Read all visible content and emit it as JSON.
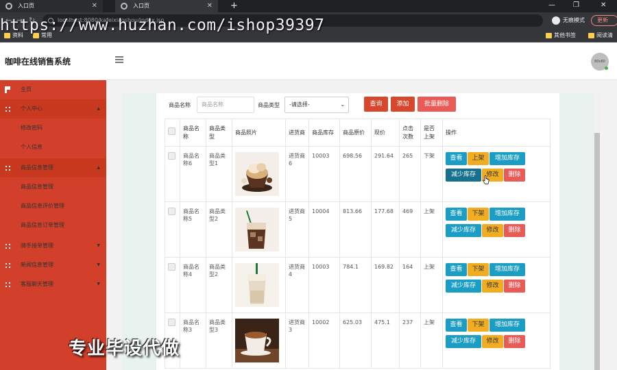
{
  "browser": {
    "tabs": [
      {
        "label": "入口页",
        "active": false
      },
      {
        "label": "入口页",
        "active": true
      }
    ],
    "new_tab": "+",
    "window_controls": {
      "minimize": "—",
      "maximize": "❐",
      "close": "✕"
    },
    "nav": {
      "back": "←",
      "forward": "→",
      "reload": "↻"
    },
    "url": "localhost:8080/kafeixiaoshou/index.jsp",
    "profile_label": "无痕模式",
    "update_label": "更新",
    "bookmarks": [
      {
        "label": "资料"
      },
      {
        "label": "常用"
      },
      {
        "label": "其他书签"
      },
      {
        "label": "阅读清单"
      }
    ],
    "watermark": "https://www.huzhan.com/ishop39397"
  },
  "app": {
    "title": "咖啡在线销售系统",
    "user_avatar_text": "80x80"
  },
  "sidebar": {
    "items": [
      {
        "label": "主页",
        "type": "home"
      },
      {
        "label": "个人中心",
        "type": "section",
        "caret": "▲"
      },
      {
        "label": "修改密码",
        "type": "sub"
      },
      {
        "label": "个人信息",
        "type": "sub"
      },
      {
        "label": "商品信息管理",
        "type": "section",
        "caret": "▲"
      },
      {
        "label": "商品信息管理",
        "type": "sub"
      },
      {
        "label": "商品信息评价管理",
        "type": "sub"
      },
      {
        "label": "商品信息订单管理",
        "type": "sub"
      },
      {
        "label": "骑手接单管理",
        "type": "section2",
        "caret": "▼"
      },
      {
        "label": "新闻信息管理",
        "type": "section2",
        "caret": "▼"
      },
      {
        "label": "客服聊天管理",
        "type": "section2",
        "caret": "▼"
      }
    ]
  },
  "overlay_caption": "专业毕设代做",
  "search": {
    "name_label": "商品名称",
    "name_placeholder": "商品名称",
    "type_label": "商品类型",
    "type_selected": "-请选择-",
    "query_btn": "查询",
    "add_btn": "添加",
    "batch_delete_btn": "批量删除"
  },
  "table": {
    "headers": [
      "商品名称",
      "商品类型",
      "商品照片",
      "进货商",
      "商品库存",
      "商品原价",
      "现价",
      "点击次数",
      "是否上架",
      "操作"
    ],
    "rows": [
      {
        "name": "商品名称6",
        "type": "商品类型1",
        "supplier": "进货商6",
        "stock": "10003",
        "orig_price": "698.56",
        "price": "291.64",
        "clicks": "265",
        "shelf": "下架",
        "toggle": "上架",
        "img": "dessert"
      },
      {
        "name": "商品名称5",
        "type": "商品类型2",
        "supplier": "进货商5",
        "stock": "10004",
        "orig_price": "813.66",
        "price": "177.68",
        "clicks": "469",
        "shelf": "上架",
        "toggle": "下架",
        "img": "iced"
      },
      {
        "name": "商品名称4",
        "type": "商品类型2",
        "supplier": "进货商4",
        "stock": "10003",
        "orig_price": "784.1",
        "price": "169.82",
        "clicks": "164",
        "shelf": "上架",
        "toggle": "下架",
        "img": "latte"
      },
      {
        "name": "商品名称3",
        "type": "商品类型3",
        "supplier": "进货商3",
        "stock": "10002",
        "orig_price": "625.03",
        "price": "475.1",
        "clicks": "237",
        "shelf": "上架",
        "toggle": "下架",
        "img": "espresso"
      }
    ],
    "op_labels": {
      "view": "查看",
      "increase": "增加库存",
      "decrease": "减少库存",
      "edit": "修改",
      "delete": "删除"
    }
  }
}
